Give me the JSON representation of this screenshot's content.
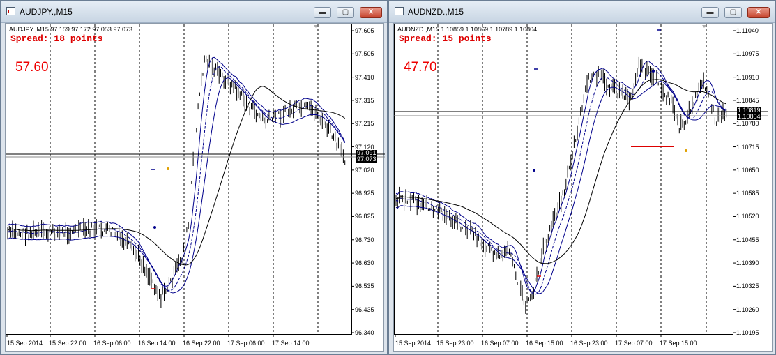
{
  "windows": [
    {
      "title": "AUDJPY.,M15",
      "controls": {
        "min": "▬",
        "max": "▢",
        "close": "✕"
      },
      "header": "AUDJPY.,M15  97.159 97.172 97.053 97.073",
      "spread": "Spread: 18 points",
      "value": "57.60",
      "price_box_upper": "97.091",
      "price_box_lower": "97.073",
      "y_ticks": [
        "97.605",
        "97.505",
        "97.410",
        "97.315",
        "97.215",
        "97.120",
        "97.020",
        "96.925",
        "96.825",
        "96.730",
        "96.630",
        "96.535",
        "96.435",
        "96.340"
      ],
      "x_ticks": [
        "15 Sep 2014",
        "15 Sep 22:00",
        "16 Sep 06:00",
        "16 Sep 14:00",
        "16 Sep 22:00",
        "17 Sep 06:00",
        "17 Sep 14:00"
      ],
      "colors": {
        "bars": "#000000",
        "ma": "#00008b",
        "spread": "#dd0000"
      }
    },
    {
      "title": "AUDNZD.,M15",
      "controls": {
        "min": "▬",
        "max": "▢",
        "close": "✕"
      },
      "header": "AUDNZD.,M15  1.10859 1.10869 1.10789 1.10804",
      "spread": "Spread: 15 points",
      "value": "47.70",
      "price_box_upper": "1.10819",
      "price_box_lower": "1.10804",
      "y_ticks": [
        "1.11040",
        "1.10975",
        "1.10910",
        "1.10845",
        "1.10780",
        "1.10715",
        "1.10650",
        "1.10585",
        "1.10520",
        "1.10455",
        "1.10390",
        "1.10325",
        "1.10260",
        "1.10195"
      ],
      "x_ticks": [
        "15 Sep 2014",
        "15 Sep 23:00",
        "16 Sep 07:00",
        "16 Sep 15:00",
        "16 Sep 23:00",
        "17 Sep 07:00",
        "17 Sep 15:00"
      ],
      "colors": {
        "bars": "#000000",
        "ma": "#00008b",
        "spread": "#dd0000"
      }
    }
  ]
}
